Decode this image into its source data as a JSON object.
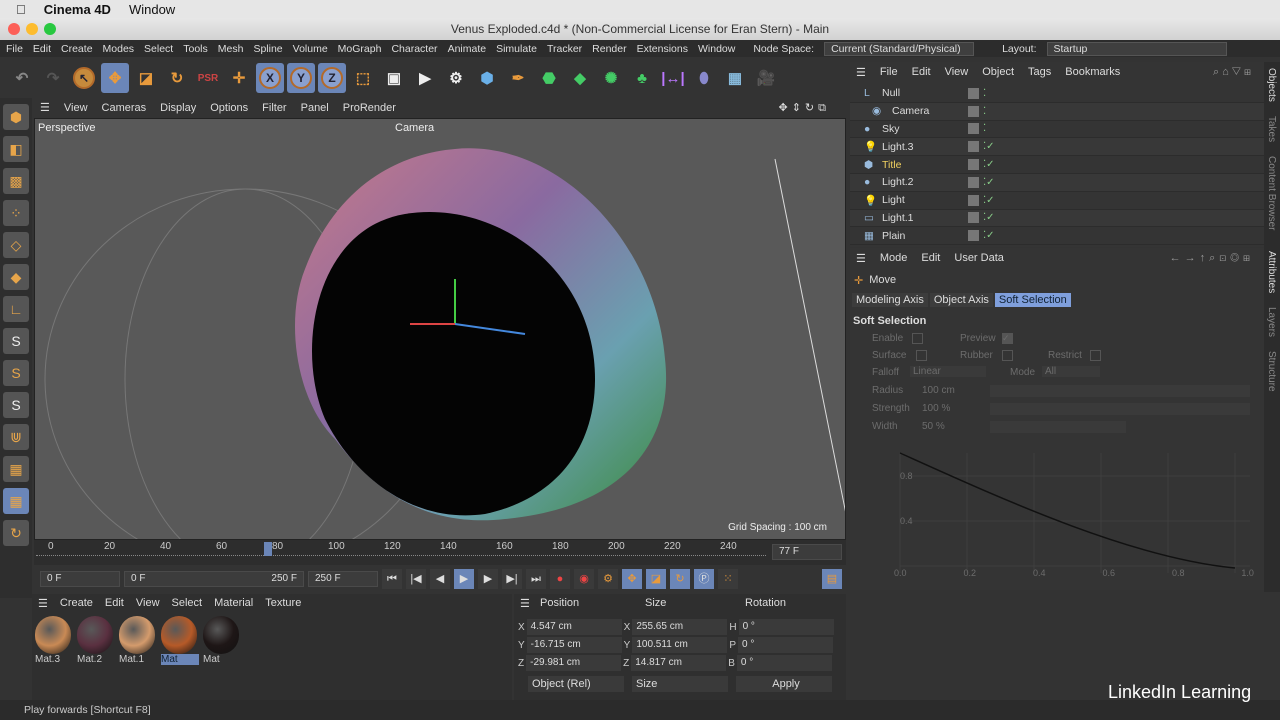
{
  "mac": {
    "app": "Cinema 4D",
    "menu": "Window"
  },
  "window": {
    "title": "Venus Exploded.c4d * (Non-Commercial License for Eran Stern) - Main"
  },
  "menu": [
    "File",
    "Edit",
    "Create",
    "Modes",
    "Select",
    "Tools",
    "Mesh",
    "Spline",
    "Volume",
    "MoGraph",
    "Character",
    "Animate",
    "Simulate",
    "Tracker",
    "Render",
    "Extensions",
    "Window"
  ],
  "node_space": {
    "label": "Node Space:",
    "value": "Current (Standard/Physical)"
  },
  "layout": {
    "label": "Layout:",
    "value": "Startup"
  },
  "viewport": {
    "menu": [
      "View",
      "Cameras",
      "Display",
      "Options",
      "Filter",
      "Panel",
      "ProRender"
    ],
    "name": "Perspective",
    "camera": "Camera",
    "grid_spacing": "Grid Spacing : 100 cm"
  },
  "timeline": {
    "ticks": [
      "0",
      "20",
      "40",
      "60",
      "80",
      "100",
      "120",
      "140",
      "160",
      "180",
      "200",
      "220",
      "240"
    ],
    "current": "77 F",
    "current_frame": 77,
    "max": 250
  },
  "controls": {
    "start": "0 F",
    "range_start": "0 F",
    "range_end": "250 F",
    "end": "250 F"
  },
  "materials": {
    "menu": [
      "Create",
      "Edit",
      "View",
      "Select",
      "Material",
      "Texture"
    ],
    "items": [
      {
        "name": "Mat.3",
        "color": "#c98a55"
      },
      {
        "name": "Mat.2",
        "color": "#5a3040"
      },
      {
        "name": "Mat.1",
        "color": "#d49b6c"
      },
      {
        "name": "Mat",
        "color": "#b65a28",
        "selected": true
      },
      {
        "name": "Mat",
        "color": "#1e1616"
      }
    ]
  },
  "coords": {
    "headers": [
      "Position",
      "Size",
      "Rotation"
    ],
    "rows": [
      {
        "a": "X",
        "p": "4.547 cm",
        "b": "X",
        "s": "255.65 cm",
        "c": "H",
        "r": "0 °"
      },
      {
        "a": "Y",
        "p": "-16.715 cm",
        "b": "Y",
        "s": "100.511 cm",
        "c": "P",
        "r": "0 °"
      },
      {
        "a": "Z",
        "p": "-29.981 cm",
        "b": "Z",
        "s": "14.817 cm",
        "c": "B",
        "r": "0 °"
      }
    ],
    "mode": "Object (Rel)",
    "size_mode": "Size",
    "apply": "Apply"
  },
  "objects": {
    "menu": [
      "File",
      "Edit",
      "View",
      "Object",
      "Tags",
      "Bookmarks"
    ],
    "items": [
      {
        "name": "Null"
      },
      {
        "name": "Camera"
      },
      {
        "name": "Sky"
      },
      {
        "name": "Light.3"
      },
      {
        "name": "Title",
        "active": true
      },
      {
        "name": "Light.2"
      },
      {
        "name": "Light"
      },
      {
        "name": "Light.1"
      },
      {
        "name": "Plain"
      }
    ]
  },
  "attributes": {
    "menu": [
      "Mode",
      "Edit",
      "User Data"
    ],
    "tool": "Move",
    "tabs": [
      "Modeling Axis",
      "Object Axis",
      "Soft Selection"
    ],
    "section": "Soft Selection",
    "fields": {
      "enable": "Enable",
      "preview": "Preview",
      "surface": "Surface",
      "rubber": "Rubber",
      "restrict": "Restrict",
      "falloff": "Falloff",
      "falloff_val": "Linear",
      "mode": "Mode",
      "mode_val": "All",
      "radius": "Radius",
      "radius_val": "100 cm",
      "strength": "Strength",
      "strength_val": "100 %",
      "width": "Width",
      "width_val": "50 %"
    },
    "graph_y": [
      "0.8",
      "0.4"
    ],
    "graph_x": [
      "0.0",
      "0.2",
      "0.4",
      "0.6",
      "0.8",
      "1.0"
    ]
  },
  "right_tabs": [
    "Objects",
    "Takes",
    "Content Browser",
    "Attributes",
    "Layers",
    "Structure"
  ],
  "status": "Play forwards [Shortcut F8]",
  "brand": "LinkedIn Learning"
}
